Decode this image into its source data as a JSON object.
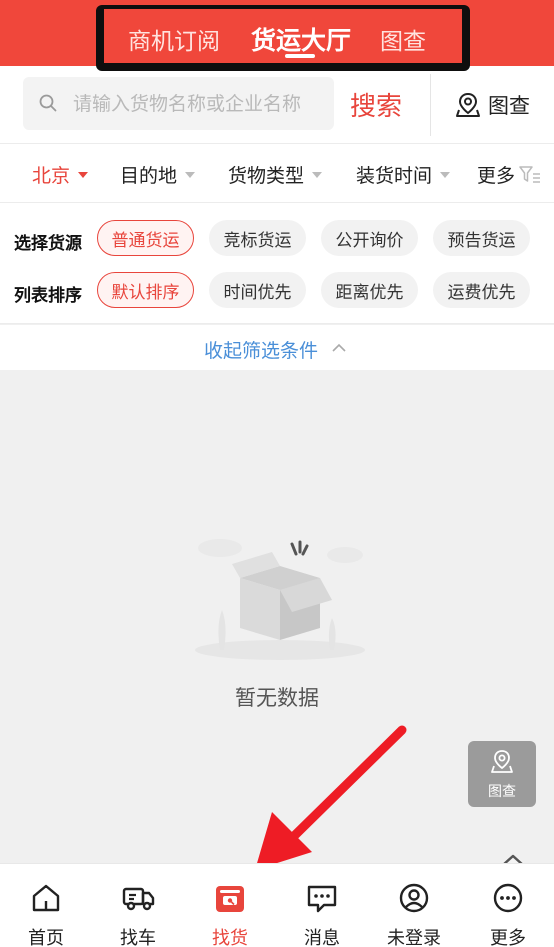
{
  "header": {
    "tabs": [
      {
        "label": "商机订阅",
        "active": false
      },
      {
        "label": "货运大厅",
        "active": true
      },
      {
        "label": "图查",
        "active": false
      }
    ]
  },
  "search": {
    "placeholder": "请输入货物名称或企业名称",
    "button_label": "搜索",
    "map_label": "图查"
  },
  "filters": [
    {
      "label": "北京",
      "active": true
    },
    {
      "label": "目的地",
      "active": false
    },
    {
      "label": "货物类型",
      "active": false
    },
    {
      "label": "装货时间",
      "active": false
    },
    {
      "label": "更多",
      "active": false
    }
  ],
  "source": {
    "label": "选择货源",
    "options": [
      {
        "label": "普通货运",
        "active": true
      },
      {
        "label": "竞标货运",
        "active": false
      },
      {
        "label": "公开询价",
        "active": false
      },
      {
        "label": "预告货运",
        "active": false
      }
    ]
  },
  "sort": {
    "label": "列表排序",
    "options": [
      {
        "label": "默认排序",
        "active": true
      },
      {
        "label": "时间优先",
        "active": false
      },
      {
        "label": "距离优先",
        "active": false
      },
      {
        "label": "运费优先",
        "active": false
      }
    ]
  },
  "collapse_label": "收起筛选条件",
  "empty_state": "暂无数据",
  "fab_label": "图查",
  "bottom_nav": [
    {
      "label": "首页",
      "icon": "home-icon",
      "active": false
    },
    {
      "label": "找车",
      "icon": "truck-icon",
      "active": false
    },
    {
      "label": "找货",
      "icon": "cargo-box-icon",
      "active": true
    },
    {
      "label": "消息",
      "icon": "message-icon",
      "active": false
    },
    {
      "label": "未登录",
      "icon": "user-icon",
      "active": false
    },
    {
      "label": "更多",
      "icon": "more-icon",
      "active": false
    }
  ],
  "colors": {
    "brand_red": "#f0473b",
    "accent_red": "#e8453c",
    "link_blue": "#4a8fd8"
  }
}
